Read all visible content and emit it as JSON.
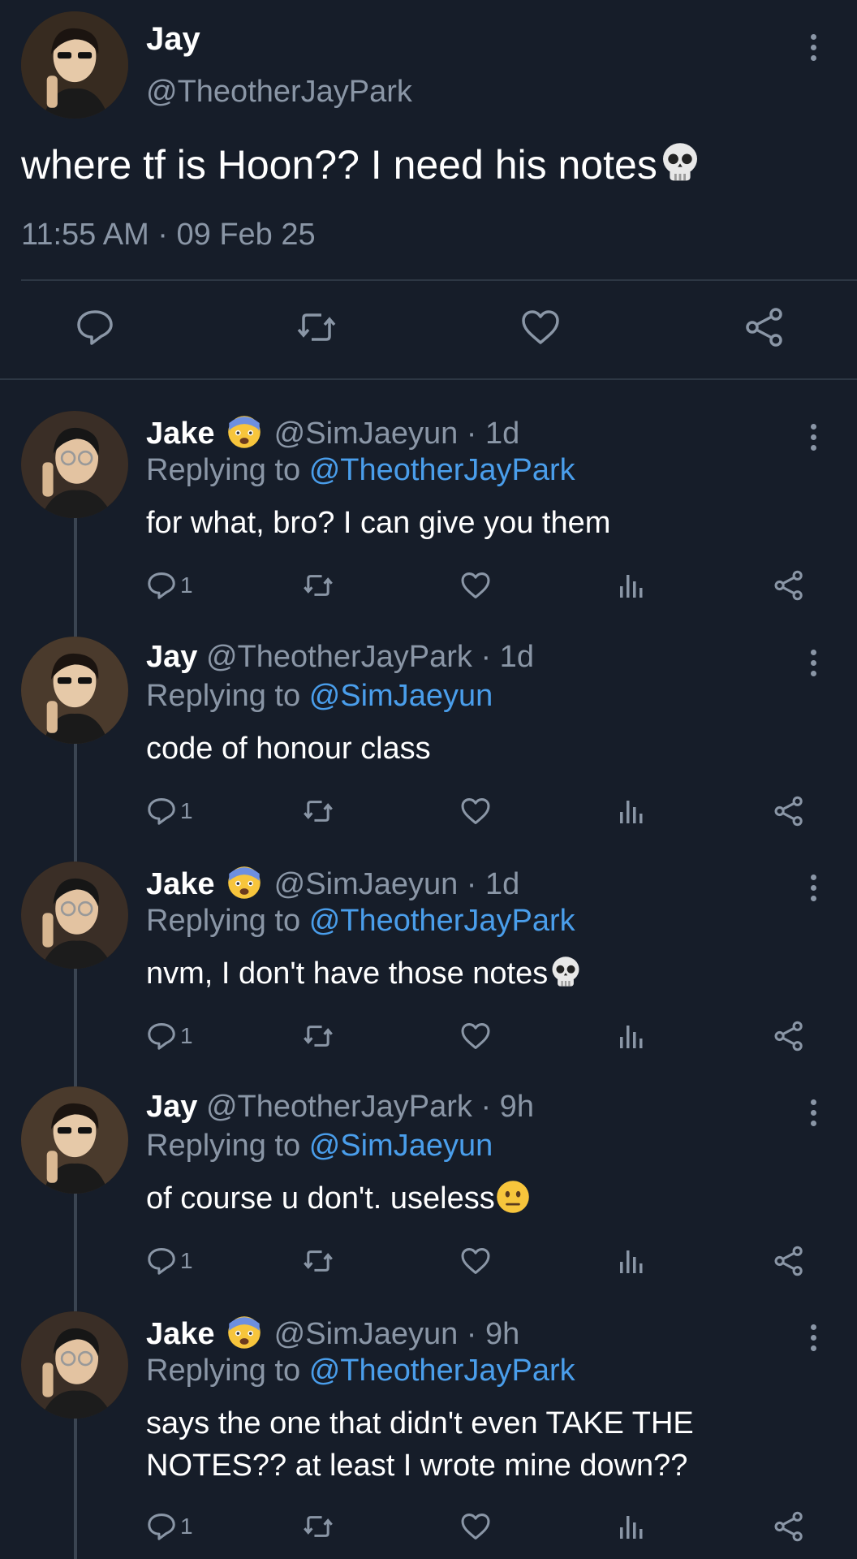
{
  "main_tweet": {
    "name": "Jay",
    "handle": "@TheotherJayPark",
    "text": "where tf is Hoon?? I need his notes",
    "text_emoji": "skull",
    "timestamp": "11:55 AM · 09 Feb 25"
  },
  "replies": [
    {
      "name": "Jake",
      "name_emoji": "fearful-face",
      "handle": "@SimJaeyun",
      "age": "· 1d",
      "replying_label": "Replying to",
      "replying_to": "@TheotherJayPark",
      "text": "for what, bro? I can give you them",
      "reply_count": "1"
    },
    {
      "name": "Jay",
      "handle": "@TheotherJayPark",
      "age": "· 1d",
      "replying_label": "Replying to",
      "replying_to": "@SimJaeyun",
      "text": "code of honour class",
      "reply_count": "1"
    },
    {
      "name": "Jake",
      "name_emoji": "fearful-face",
      "handle": "@SimJaeyun",
      "age": "· 1d",
      "replying_label": "Replying to",
      "replying_to": "@TheotherJayPark",
      "text": "nvm, I don't have those notes",
      "text_emoji": "skull",
      "reply_count": "1"
    },
    {
      "name": "Jay",
      "handle": "@TheotherJayPark",
      "age": "· 9h",
      "replying_label": "Replying to",
      "replying_to": "@SimJaeyun",
      "text": "of course u don't. useless",
      "text_emoji": "neutral-face",
      "reply_count": "1"
    },
    {
      "name": "Jake",
      "name_emoji": "fearful-face",
      "handle": "@SimJaeyun",
      "age": "· 9h",
      "replying_label": "Replying to",
      "replying_to": "@TheotherJayPark",
      "text": "says the one that didn't even TAKE THE NOTES?? at least I wrote mine down??",
      "reply_count": "1"
    }
  ],
  "colors": {
    "background": "#161d29",
    "muted_text": "#8a96a6",
    "link": "#4a9eeb",
    "divider": "#2d3744"
  },
  "icons": [
    "reply-icon",
    "retweet-icon",
    "like-icon",
    "share-icon",
    "views-icon",
    "more-options-icon",
    "skull-emoji",
    "fearful-face-emoji",
    "neutral-face-emoji"
  ]
}
